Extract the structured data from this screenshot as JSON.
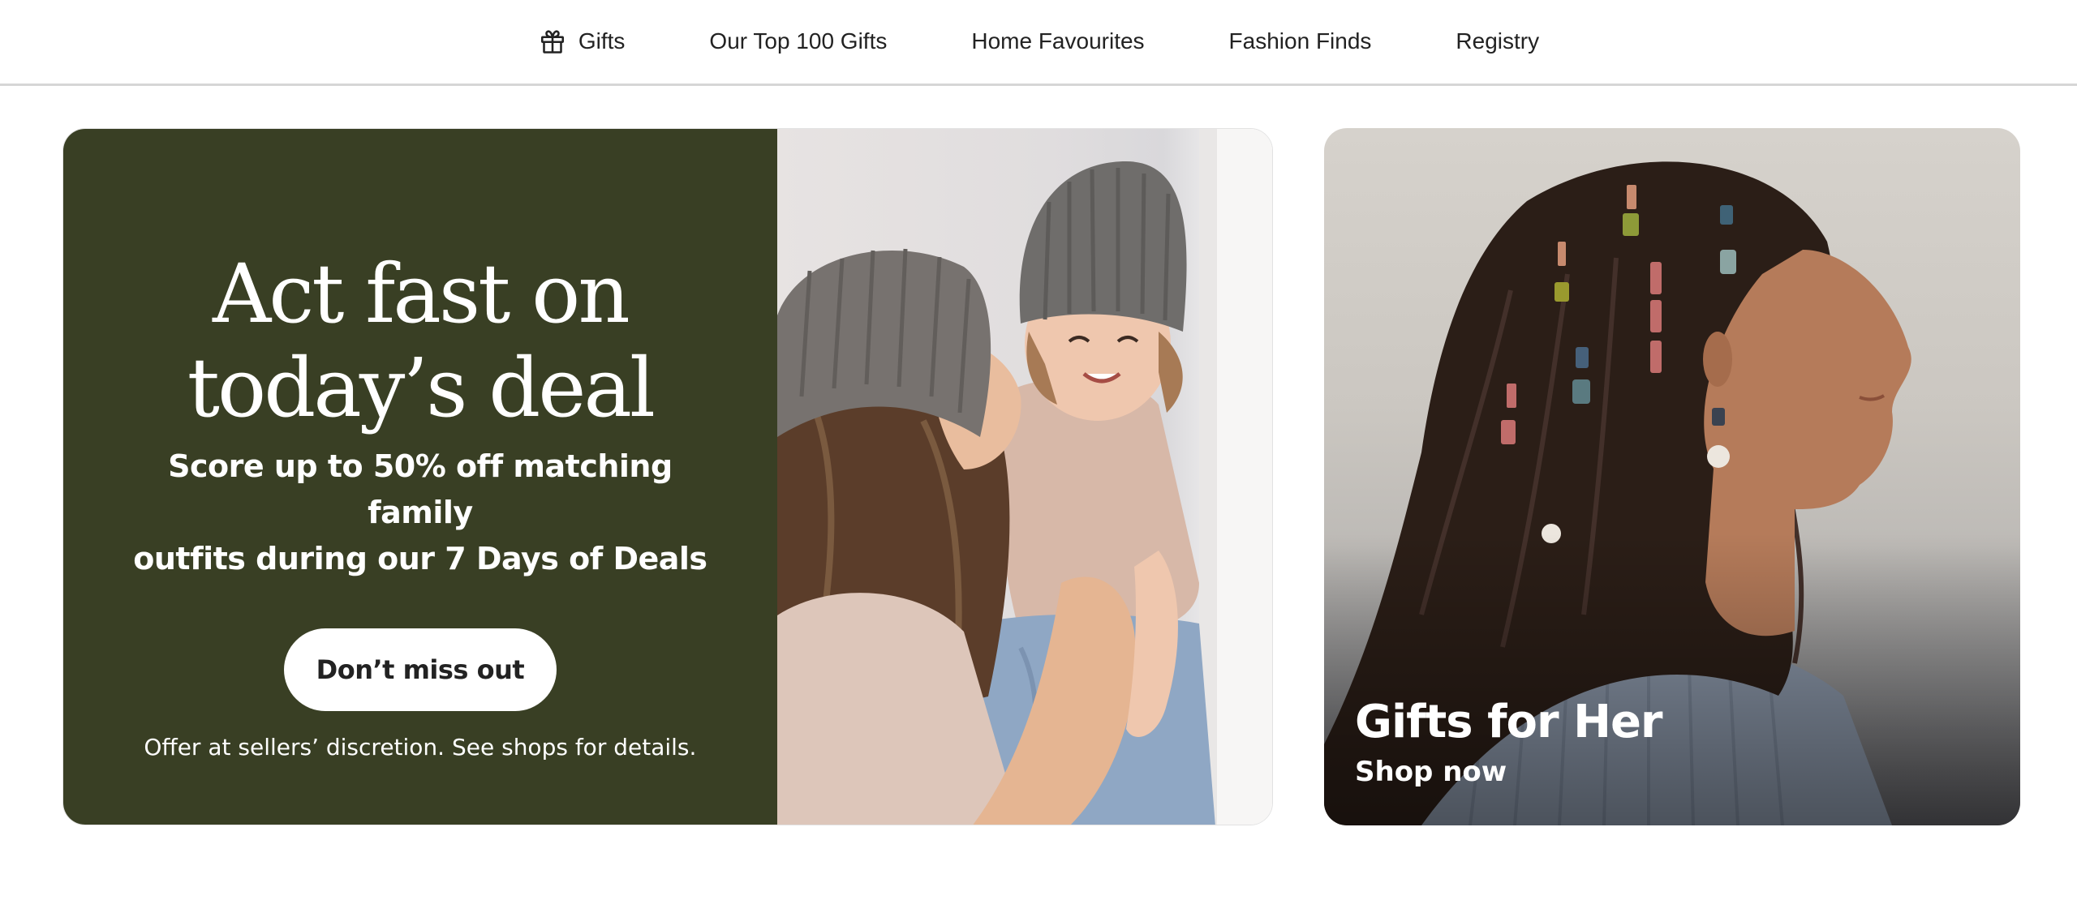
{
  "nav": {
    "items": [
      {
        "label": "Gifts",
        "icon": "gift-icon"
      },
      {
        "label": "Our Top 100 Gifts"
      },
      {
        "label": "Home Favourites"
      },
      {
        "label": "Fashion Finds"
      },
      {
        "label": "Registry"
      }
    ]
  },
  "hero": {
    "headline_line1": "Act fast on",
    "headline_line2": "today’s deal",
    "subtitle_line1": "Score up to 50% off matching family",
    "subtitle_line2": "outfits during our 7 Days of Deals",
    "button_label": "Don’t miss out",
    "fine_print": "Offer at sellers’ discretion. See shops for details.",
    "background_color": "#393f24",
    "image": "mother-kissing-child-in-knit-beanies-photo"
  },
  "promo": {
    "title": "Gifts for Her",
    "link_label": "Shop now",
    "image": "woman-with-jeweled-hair-pins-photo"
  }
}
